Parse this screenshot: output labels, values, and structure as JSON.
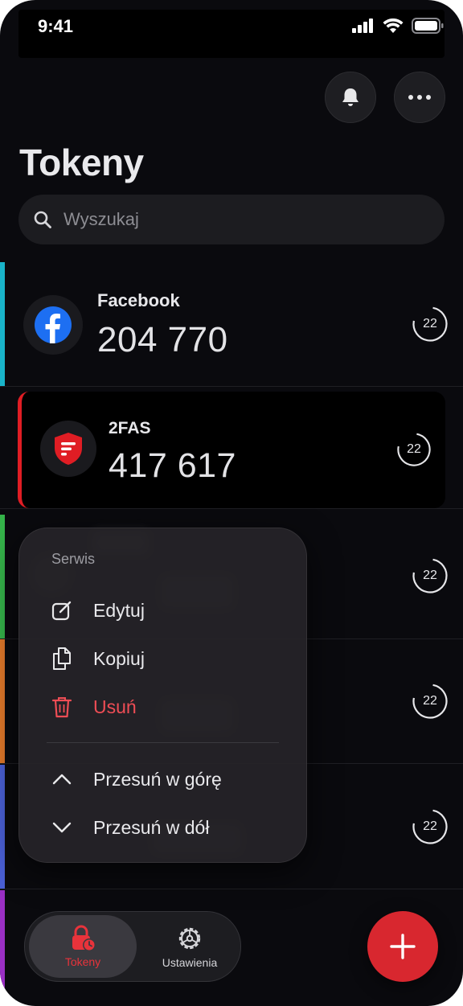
{
  "status_bar": {
    "time": "9:41"
  },
  "header": {
    "title": "Tokeny"
  },
  "search": {
    "placeholder": "Wyszukaj"
  },
  "tokens": [
    {
      "service": "Facebook",
      "code": "204 770",
      "timer": "22",
      "accent": "#19b4c9"
    },
    {
      "service": "2FAS",
      "code": "417 617",
      "timer": "22",
      "accent": "#e01d24"
    },
    {
      "timer": "22",
      "accent": "#35b34a"
    },
    {
      "timer": "22",
      "accent": "#e0782a"
    },
    {
      "timer": "22",
      "accent": "#4a5fd4"
    },
    {
      "accent": "#9a2fc4"
    }
  ],
  "context_menu": {
    "header": "Serwis",
    "edit": "Edytuj",
    "copy": "Kopiuj",
    "delete": "Usuń",
    "move_up": "Przesuń w górę",
    "move_down": "Przesuń w dół"
  },
  "tab_bar": {
    "tokens": "Tokeny",
    "settings": "Ustawienia"
  },
  "colors": {
    "brand_red": "#d8272f",
    "danger_red": "#ef4d55",
    "background": "#0a0a0e"
  },
  "icons": [
    "bell-icon",
    "more-icon",
    "search-icon",
    "facebook-logo",
    "2fas-logo",
    "edit-icon",
    "copy-icon",
    "trash-icon",
    "chevron-up-icon",
    "chevron-down-icon",
    "lock-clock-icon",
    "gear-icon",
    "plus-icon"
  ]
}
